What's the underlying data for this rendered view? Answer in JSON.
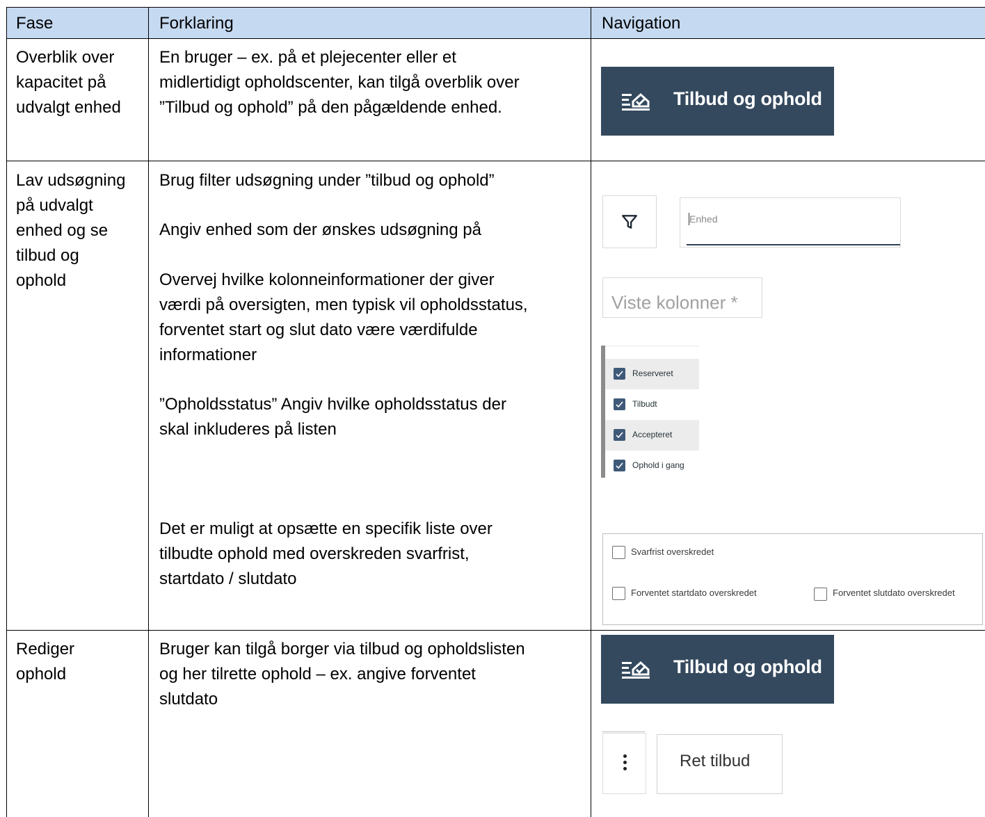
{
  "table": {
    "headers": {
      "fase": "Fase",
      "forklaring": "Forklaring",
      "navigation": "Navigation"
    },
    "rows": [
      {
        "fase": [
          "Overblik over",
          "kapacitet på",
          "udvalgt enhed"
        ],
        "forklaring": [
          "En bruger – ex. på et plejecenter eller et",
          "midlertidigt opholdscenter, kan tilgå overblik over",
          "”Tilbud og ophold” på den pågældende enhed."
        ]
      },
      {
        "fase": [
          "Lav udsøgning",
          "på udvalgt",
          "enhed og se",
          "tilbud og",
          "ophold"
        ],
        "forklaring": {
          "p1": "Brug filter udsøgning under ”tilbud og ophold”",
          "p2": "Angiv enhed som der ønskes udsøgning på",
          "p3": [
            "Overvej hvilke kolonneinformationer der giver",
            "værdi på oversigten, men typisk vil opholdsstatus,",
            "forventet start og slut dato være værdifulde",
            "informationer"
          ],
          "p4": [
            "”Opholdsstatus” Angiv hvilke opholdsstatus der",
            "skal inkluderes på listen"
          ],
          "p5": [
            "Det er muligt at opsætte en specifik liste over",
            "tilbudte ophold med overskreden svarfrist,",
            "startdato / slutdato"
          ]
        }
      },
      {
        "fase": [
          "Rediger",
          "ophold"
        ],
        "forklaring": [
          "Bruger kan tilgå borger via tilbud og opholdslisten",
          "og her tilrette ophold – ex. angive forventet",
          "slutdato"
        ]
      }
    ]
  },
  "navigation": {
    "menu_item_label": "Tilbud og ophold",
    "menu_item_icon": "list-check-icon",
    "nav_color": "#34495e",
    "unit_field_placeholder": "Enhed",
    "columns_field_placeholder": "Viste kolonner *",
    "status_options": [
      "Reserveret",
      "Tilbudt",
      "Accepteret",
      "Ophold i gang"
    ],
    "exceeded_options": [
      "Svarfrist overskredet",
      "Forventet startdato overskredet",
      "Forventet slutdato overskredet"
    ],
    "edit_button_label": "Ret tilbud"
  }
}
